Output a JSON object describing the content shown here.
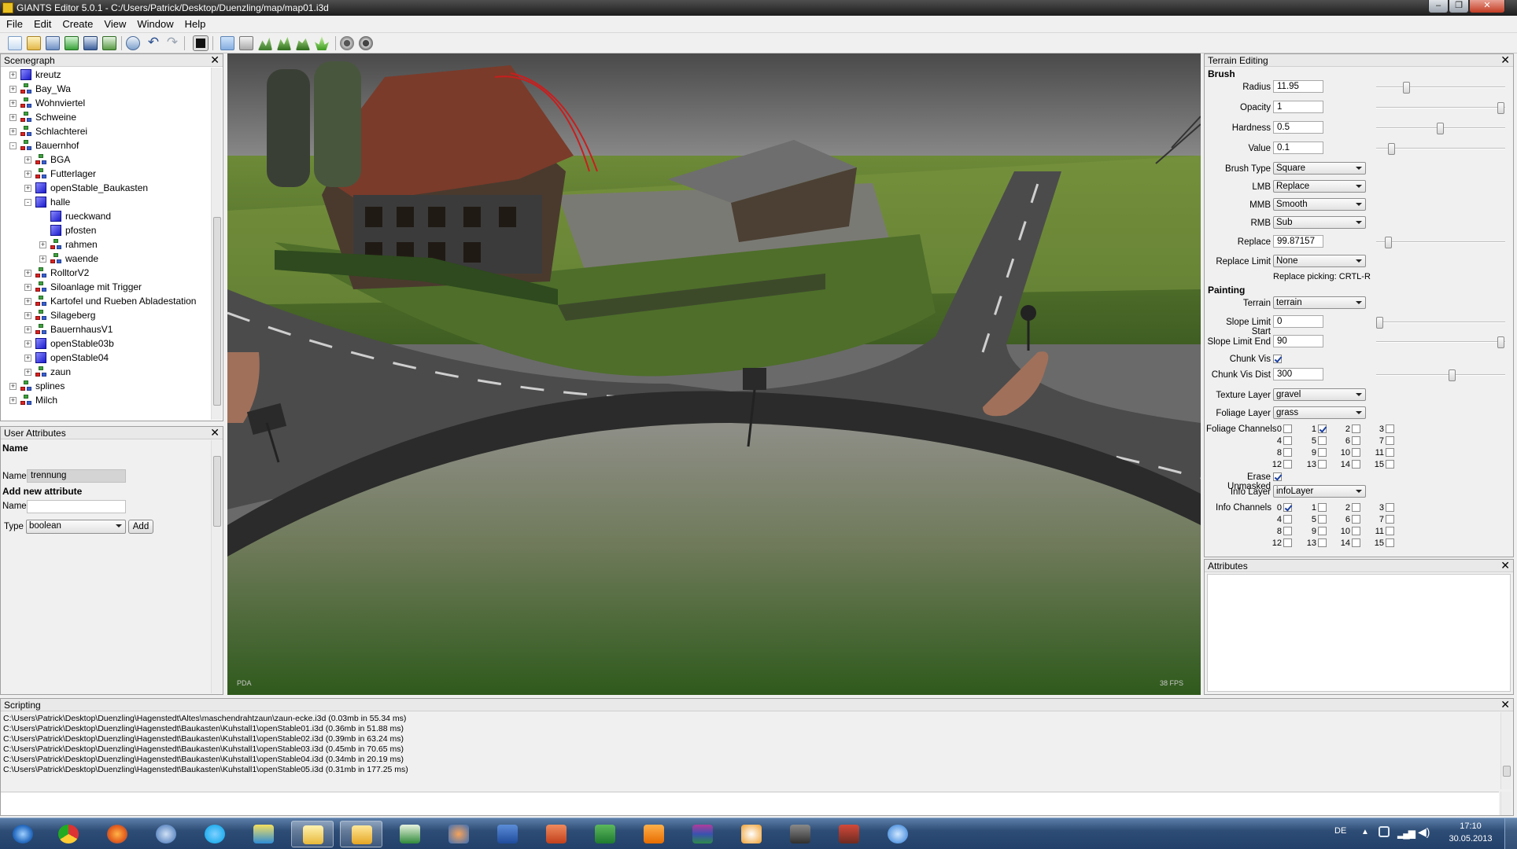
{
  "window": {
    "title": "GIANTS Editor 5.0.1 - C:/Users/Patrick/Desktop/Duenzling/map/map01.i3d"
  },
  "menu": [
    "File",
    "Edit",
    "Create",
    "View",
    "Window",
    "Help"
  ],
  "toolbar_icons": [
    "new-icon",
    "open-icon",
    "save-icon",
    "refresh-icon",
    "save-as-icon",
    "save-all-icon",
    "import-icon",
    "undo-icon",
    "redo-icon",
    "stop-icon",
    "select-tool-icon",
    "move-tool-icon",
    "terrain-sculpt-icon",
    "terrain-paint-icon",
    "terrain-smooth-icon",
    "foliage-paint-icon",
    "camera-icon",
    "camera-settings-icon"
  ],
  "scenegraph": {
    "title": "Scenegraph",
    "items": [
      {
        "label": "kreutz",
        "type": "shape",
        "depth": 0,
        "exp": "+"
      },
      {
        "label": "Bay_Wa",
        "type": "group",
        "depth": 0,
        "exp": "+"
      },
      {
        "label": "Wohnviertel",
        "type": "group",
        "depth": 0,
        "exp": "+"
      },
      {
        "label": "Schweine",
        "type": "group",
        "depth": 0,
        "exp": "+"
      },
      {
        "label": "Schlachterei",
        "type": "group",
        "depth": 0,
        "exp": "+"
      },
      {
        "label": "Bauernhof",
        "type": "group",
        "depth": 0,
        "exp": "-"
      },
      {
        "label": "BGA",
        "type": "group",
        "depth": 1,
        "exp": "+"
      },
      {
        "label": "Futterlager",
        "type": "group",
        "depth": 1,
        "exp": "+"
      },
      {
        "label": "openStable_Baukasten",
        "type": "shape",
        "depth": 1,
        "exp": "+"
      },
      {
        "label": "halle",
        "type": "shape",
        "depth": 1,
        "exp": "-"
      },
      {
        "label": "rueckwand",
        "type": "shape",
        "depth": 2,
        "exp": ""
      },
      {
        "label": "pfosten",
        "type": "shape",
        "depth": 2,
        "exp": ""
      },
      {
        "label": "rahmen",
        "type": "group",
        "depth": 2,
        "exp": "+"
      },
      {
        "label": "waende",
        "type": "group",
        "depth": 2,
        "exp": "+"
      },
      {
        "label": "RolltorV2",
        "type": "group",
        "depth": 1,
        "exp": "+"
      },
      {
        "label": "Siloanlage mit Trigger",
        "type": "group",
        "depth": 1,
        "exp": "+"
      },
      {
        "label": "Kartofel und Rueben Abladestation",
        "type": "group",
        "depth": 1,
        "exp": "+"
      },
      {
        "label": "Silageberg",
        "type": "group",
        "depth": 1,
        "exp": "+"
      },
      {
        "label": "BauernhausV1",
        "type": "group",
        "depth": 1,
        "exp": "+"
      },
      {
        "label": "openStable03b",
        "type": "shape",
        "depth": 1,
        "exp": "+"
      },
      {
        "label": "openStable04",
        "type": "shape",
        "depth": 1,
        "exp": "+"
      },
      {
        "label": "zaun",
        "type": "group",
        "depth": 1,
        "exp": "+"
      },
      {
        "label": "splines",
        "type": "group",
        "depth": 0,
        "exp": "+"
      },
      {
        "label": "Milch",
        "type": "group",
        "depth": 0,
        "exp": "+"
      }
    ]
  },
  "user_attributes": {
    "title": "User Attributes",
    "name_header": "Name",
    "name_label": "Name",
    "name_value": "trennung",
    "add_header": "Add new attribute",
    "new_name_label": "Name",
    "new_name_value": "",
    "type_label": "Type",
    "type_value": "boolean",
    "add_button": "Add"
  },
  "viewport": {
    "corner_left": "PDA",
    "fps": "38 FPS"
  },
  "terrain": {
    "title": "Terrain Editing",
    "brush_header": "Brush",
    "radius_label": "Radius",
    "radius_value": "11.95",
    "radius_level": 0.22,
    "opacity_label": "Opacity",
    "opacity_value": "1",
    "opacity_level": 1.0,
    "hardness_label": "Hardness",
    "hardness_value": "0.5",
    "hardness_level": 0.5,
    "value_label": "Value",
    "value_value": "0.1",
    "value_level": 0.1,
    "brushtype_label": "Brush Type",
    "brushtype_value": "Square",
    "lmb_label": "LMB",
    "lmb_value": "Replace",
    "mmb_label": "MMB",
    "mmb_value": "Smooth",
    "rmb_label": "RMB",
    "rmb_value": "Sub",
    "replace_label": "Replace",
    "replace_value": "99.87157",
    "replace_level": 0.07,
    "replacelimit_label": "Replace Limit",
    "replacelimit_value": "None",
    "replace_picking": "Replace picking: CRTL-R",
    "painting_header": "Painting",
    "terrain_label": "Terrain",
    "terrain_value": "terrain",
    "slopestart_label": "Slope Limit Start",
    "slopestart_value": "0",
    "slopestart_level": 0.0,
    "slopeend_label": "Slope Limit End",
    "slopeend_value": "90",
    "slopeend_level": 1.0,
    "chunkvis_label": "Chunk Vis",
    "chunkvis_checked": true,
    "chunkdist_label": "Chunk Vis Dist",
    "chunkdist_value": "300",
    "chunkdist_level": 0.6,
    "texture_label": "Texture Layer",
    "texture_value": "gravel",
    "foliage_label": "Foliage Layer",
    "foliage_value": "grass",
    "foliagech_label": "Foliage Channels",
    "foliage_channels": [
      {
        "n": "0",
        "on": false
      },
      {
        "n": "1",
        "on": true
      },
      {
        "n": "2",
        "on": false
      },
      {
        "n": "3",
        "on": false
      },
      {
        "n": "4",
        "on": false
      },
      {
        "n": "5",
        "on": false
      },
      {
        "n": "6",
        "on": false
      },
      {
        "n": "7",
        "on": false
      },
      {
        "n": "8",
        "on": false
      },
      {
        "n": "9",
        "on": false
      },
      {
        "n": "10",
        "on": false
      },
      {
        "n": "11",
        "on": false
      },
      {
        "n": "12",
        "on": false
      },
      {
        "n": "13",
        "on": false
      },
      {
        "n": "14",
        "on": false
      },
      {
        "n": "15",
        "on": false
      }
    ],
    "erase_label": "Erase Unmasked",
    "erase_checked": true,
    "infolayer_label": "Info Layer",
    "infolayer_value": "infoLayer",
    "infoch_label": "Info Channels",
    "info_channels": [
      {
        "n": "0",
        "on": true
      },
      {
        "n": "1",
        "on": false
      },
      {
        "n": "2",
        "on": false
      },
      {
        "n": "3",
        "on": false
      },
      {
        "n": "4",
        "on": false
      },
      {
        "n": "5",
        "on": false
      },
      {
        "n": "6",
        "on": false
      },
      {
        "n": "7",
        "on": false
      },
      {
        "n": "8",
        "on": false
      },
      {
        "n": "9",
        "on": false
      },
      {
        "n": "10",
        "on": false
      },
      {
        "n": "11",
        "on": false
      },
      {
        "n": "12",
        "on": false
      },
      {
        "n": "13",
        "on": false
      },
      {
        "n": "14",
        "on": false
      },
      {
        "n": "15",
        "on": false
      }
    ]
  },
  "attributes": {
    "title": "Attributes"
  },
  "scripting": {
    "title": "Scripting",
    "lines": [
      "C:\\Users\\Patrick\\Desktop\\Duenzling\\Hagenstedt\\Altes\\maschendrahtzaun\\zaun-ecke.i3d (0.03mb in 55.34 ms)",
      "C:\\Users\\Patrick\\Desktop\\Duenzling\\Hagenstedt\\Baukasten\\Kuhstall1\\openStable01.i3d (0.36mb in 51.88 ms)",
      "C:\\Users\\Patrick\\Desktop\\Duenzling\\Hagenstedt\\Baukasten\\Kuhstall1\\openStable02.i3d (0.39mb in 63.24 ms)",
      "C:\\Users\\Patrick\\Desktop\\Duenzling\\Hagenstedt\\Baukasten\\Kuhstall1\\openStable03.i3d (0.45mb in 70.65 ms)",
      "C:\\Users\\Patrick\\Desktop\\Duenzling\\Hagenstedt\\Baukasten\\Kuhstall1\\openStable04.i3d (0.34mb in 20.19 ms)",
      "C:\\Users\\Patrick\\Desktop\\Duenzling\\Hagenstedt\\Baukasten\\Kuhstall1\\openStable05.i3d (0.31mb in 177.25 ms)"
    ]
  },
  "taskbar": {
    "apps": [
      "start-orb-icon",
      "chrome-icon",
      "firefox-icon",
      "thunderbird-icon",
      "skype-icon",
      "media-icon",
      "explorer-icon",
      "giants-editor-icon",
      "excel-chart-icon",
      "blender-icon",
      "word-icon",
      "powerpoint-icon",
      "excel-icon",
      "vlc-icon",
      "winrar-icon",
      "video-player-icon",
      "tractor-icon",
      "farming-simulator-icon",
      "itunes-icon"
    ],
    "lang": "DE",
    "time": "17:10",
    "date": "30.05.2013"
  }
}
